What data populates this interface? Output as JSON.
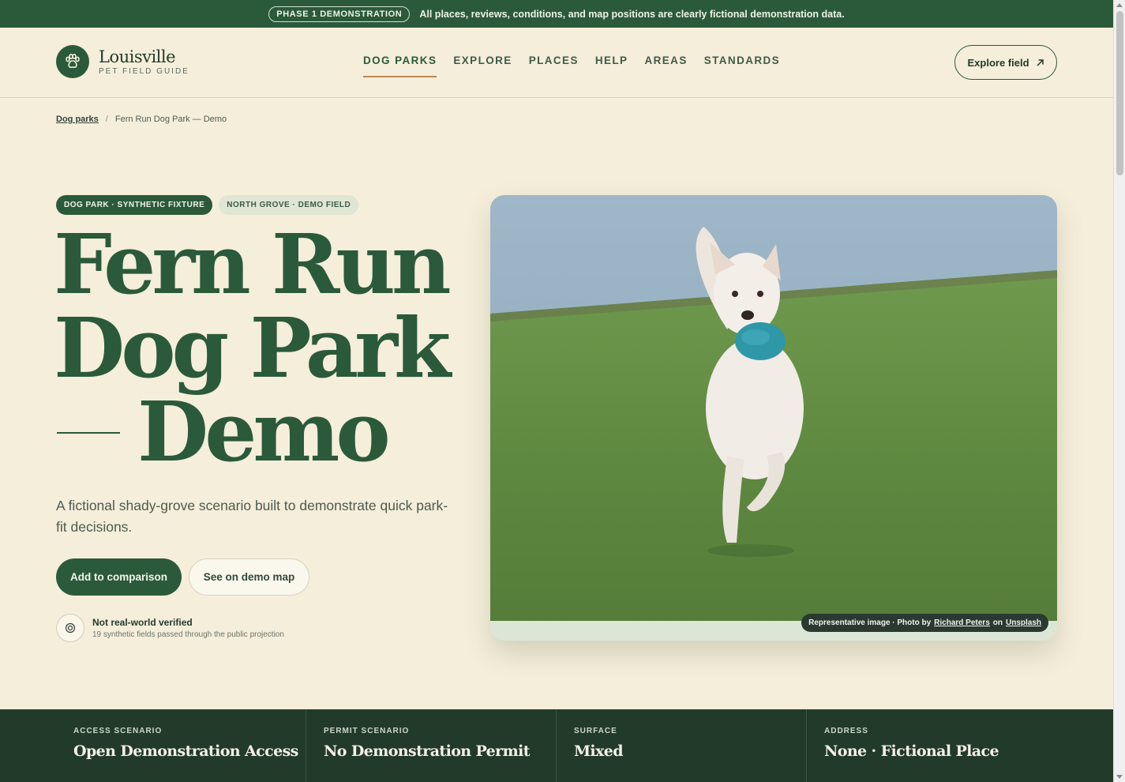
{
  "announcement": {
    "badge": "PHASE 1 DEMONSTRATION",
    "text": "All places, reviews, conditions, and map positions are clearly fictional demonstration data."
  },
  "header": {
    "logo_title": "Louisville",
    "logo_subtitle": "PET FIELD GUIDE",
    "logo_icon": "paw-icon",
    "nav": [
      {
        "label": "DOG PARKS",
        "active": true
      },
      {
        "label": "EXPLORE"
      },
      {
        "label": "PLACES"
      },
      {
        "label": "HELP"
      },
      {
        "label": "AREAS"
      },
      {
        "label": "STANDARDS"
      }
    ],
    "explore_button": "Explore field",
    "explore_icon": "arrow-up-right-icon"
  },
  "breadcrumb": {
    "parent": "Dog parks",
    "separator": "/",
    "current": "Fern Run Dog Park — Demo"
  },
  "hero": {
    "chip_primary": "DOG PARK · SYNTHETIC FIXTURE",
    "chip_secondary": "NORTH GROVE · DEMO FIELD",
    "title_line1": "Fern Run",
    "title_line2": "Dog Park",
    "title_line3": "Demo",
    "description": "A fictional shady-grove scenario built to demonstrate quick park-fit decisions.",
    "primary_button": "Add to comparison",
    "secondary_button": "See on demo map",
    "verify_title": "Not real-world verified",
    "verify_detail": "19 synthetic fields passed through the public projection",
    "verify_icon": "target-icon"
  },
  "photo": {
    "credit_prefix": "Representative image · Photo by",
    "credit_author": "Richard Peters",
    "credit_mid": "on",
    "credit_source": "Unsplash"
  },
  "stats": [
    {
      "label": "ACCESS SCENARIO",
      "value": "Open Demonstration Access"
    },
    {
      "label": "PERMIT SCENARIO",
      "value": "No Demonstration Permit"
    },
    {
      "label": "SURFACE",
      "value": "Mixed"
    },
    {
      "label": "ADDRESS",
      "value": "None · Fictional Place"
    }
  ],
  "colors": {
    "brand_green": "#2b5a3b",
    "dark_green": "#223a2a",
    "cream": "#f5eedb",
    "accent_copper": "#c0884c"
  }
}
